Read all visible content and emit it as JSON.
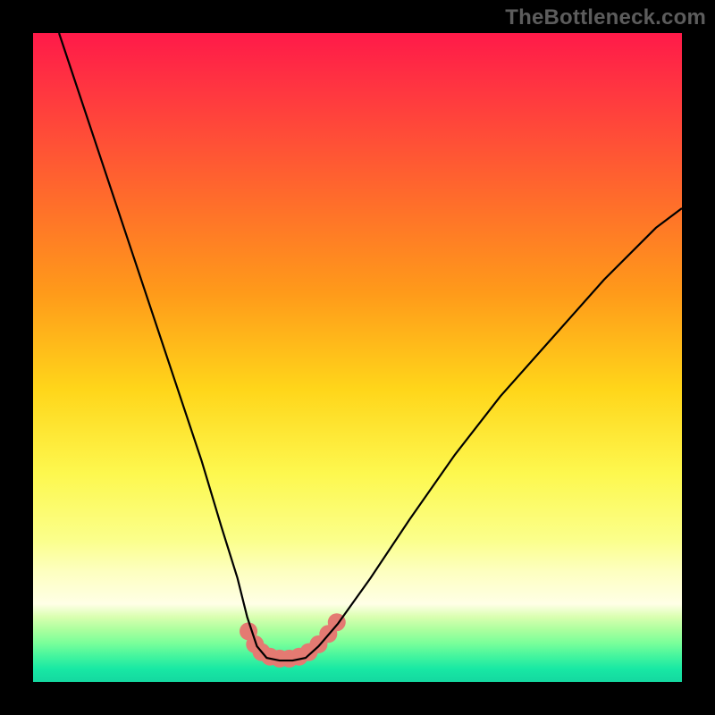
{
  "watermark": "TheBottleneck.com",
  "chart_data": {
    "type": "line",
    "title": "",
    "xlabel": "",
    "ylabel": "",
    "xlim": [
      0,
      100
    ],
    "ylim": [
      0,
      100
    ],
    "series": [
      {
        "name": "bottleneck-curve",
        "x": [
          4,
          7,
          10,
          14,
          18,
          22,
          26,
          29,
          31.5,
          33,
          34.5,
          36,
          38,
          40,
          42,
          44,
          47,
          52,
          58,
          65,
          72,
          80,
          88,
          96,
          100
        ],
        "y": [
          100,
          91,
          82,
          70,
          58,
          46,
          34,
          24,
          16,
          10,
          5.5,
          3.7,
          3.3,
          3.3,
          3.7,
          5.5,
          9,
          16,
          25,
          35,
          44,
          53,
          62,
          70,
          73
        ],
        "stroke": "#000000",
        "stroke_width": 2.2
      },
      {
        "name": "trough-markers",
        "type": "scatter",
        "x": [
          33.2,
          34.2,
          35.2,
          36.5,
          38,
          39.5,
          41,
          42.5,
          44,
          45.5,
          46.8
        ],
        "y": [
          7.8,
          5.8,
          4.6,
          3.9,
          3.6,
          3.6,
          3.9,
          4.6,
          5.8,
          7.4,
          9.2
        ],
        "marker_color": "#e47a72",
        "marker_radius": 10
      }
    ]
  },
  "layout": {
    "frame_size": 800,
    "plot_inset": 37
  }
}
